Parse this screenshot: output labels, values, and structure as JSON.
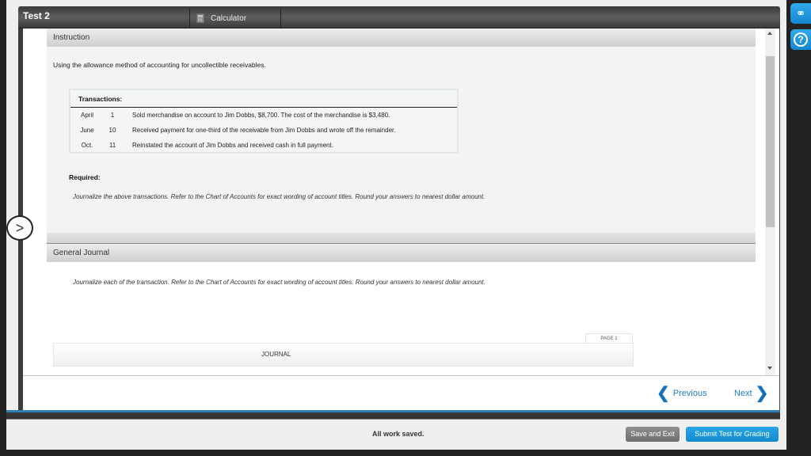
{
  "header": {
    "test_title": "Test 2",
    "calculator_label": "Calculator"
  },
  "instruction": {
    "section_title": "Instruction",
    "lead_text": "Using the allowance method of accounting for uncollectible receivables.",
    "transactions_title": "Transactions:",
    "transactions": [
      {
        "month": "April",
        "day": "1",
        "description": "Sold merchandise on account to Jim Dobbs, $8,700. The cost of the merchandise is $3,480."
      },
      {
        "month": "June",
        "day": "10",
        "description": "Received payment for one-third of the receivable from Jim Dobbs and wrote off the remainder."
      },
      {
        "month": "Oct.",
        "day": "11",
        "description": "Reinstated the account of Jim Dobbs and received cash in full payment."
      }
    ],
    "required_label": "Required:",
    "required_text": "Journalize the above transactions. Refer to the Chart of Accounts for exact wording of account titles. Round your answers to nearest dollar amount."
  },
  "general_journal": {
    "section_title": "General Journal",
    "instructions": "Journalize each of the transaction. Refer to the Chart of Accounts for exact wording of account titles. Round your answers to nearest dollar amount.",
    "page_tab": "PAGE 1",
    "journal_header": "JOURNAL"
  },
  "navigation": {
    "previous_label": "Previous",
    "next_label": "Next"
  },
  "footer": {
    "status_text": "All work saved.",
    "save_exit_label": "Save and Exit",
    "submit_label": "Submit Test for Grading"
  },
  "colors": {
    "accent_blue": "#1f7bc1",
    "submit_blue": "#1a96dc",
    "save_gray": "#7e7e7e"
  }
}
